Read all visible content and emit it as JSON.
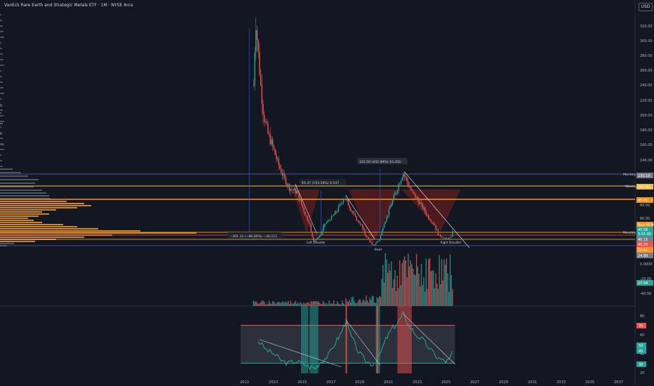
{
  "header": {
    "title": "VanEck Rare Earth and Strategic Metals ETF · 1M · NYSE Arca",
    "currency_button": "USD"
  },
  "chart_data": [
    {
      "type": "candlestick",
      "panel": "price",
      "x_ticks": [
        "2011",
        "2013",
        "2015",
        "2017",
        "2019",
        "2021",
        "2023",
        "2025",
        "2027",
        "2029",
        "2031",
        "2033",
        "2035",
        "2037"
      ],
      "y_ticks": [
        320,
        300,
        280,
        260,
        240,
        220,
        200,
        180,
        160,
        140,
        80,
        60,
        "0.0000",
        "-20.00",
        "-40.00"
      ],
      "price_series": [
        [
          "2011.6",
          240
        ],
        [
          "2011.75",
          330
        ],
        [
          "2011.9",
          290
        ],
        [
          "2012.1",
          240
        ],
        [
          "2012.3",
          200
        ],
        [
          "2012.6",
          175
        ],
        [
          "2012.9",
          160
        ],
        [
          "2013.3",
          135
        ],
        [
          "2013.7",
          115
        ],
        [
          "2014.1",
          100
        ],
        [
          "2014.6",
          95
        ],
        [
          "2015.0",
          75
        ],
        [
          "2015.4",
          55
        ],
        [
          "2015.8",
          28
        ],
        [
          "2016.3",
          40
        ],
        [
          "2016.8",
          55
        ],
        [
          "2017.4",
          70
        ],
        [
          "2017.9",
          88
        ],
        [
          "2018.3",
          75
        ],
        [
          "2018.9",
          52
        ],
        [
          "2019.5",
          35
        ],
        [
          "2019.9",
          21
        ],
        [
          "2020.3",
          30
        ],
        [
          "2020.7",
          52
        ],
        [
          "2021.1",
          75
        ],
        [
          "2021.6",
          100
        ],
        [
          "2022.0",
          122
        ],
        [
          "2022.5",
          98
        ],
        [
          "2023.0",
          85
        ],
        [
          "2023.5",
          70
        ],
        [
          "2024.0",
          52
        ],
        [
          "2024.5",
          38
        ],
        [
          "2025.0",
          32
        ],
        [
          "2025.3",
          34
        ],
        [
          "2025.5",
          45
        ]
      ],
      "annotations": {
        "rise_measure": "65.47 (193.58%) 6,547",
        "big_rise_measure": "103.50 (432.89%) 10,350",
        "drop_measure": "−301.12 (−86.80%) −30,112",
        "left_shoulder": "Left Shoulder",
        "head": "Head",
        "right_shoulder": "Right Shoulder",
        "monthly_upper": "Monthly",
        "weekly": "Weekly",
        "monthly_lower": "Monthly"
      },
      "price_labels": [
        {
          "text": "130.18",
          "color": "#787b86"
        },
        {
          "text": "102.52",
          "color": "#f0c24c"
        },
        {
          "text": "85.41",
          "color": "#f7931a"
        },
        {
          "text": "Buy 46.90",
          "color": "#f7931a"
        },
        {
          "text": "45.56",
          "color": "#26a69a"
        },
        {
          "text": "3:01:00",
          "color": "#26a69a"
        },
        {
          "text": "40.15",
          "color": "#787b86"
        },
        {
          "text": "40.25",
          "color": "#ef5350"
        },
        {
          "text": "32.51",
          "color": "#f7931a"
        },
        {
          "text": "24.89",
          "color": "#787b86"
        },
        {
          "text": "27.58",
          "color": "#26a69a"
        }
      ]
    },
    {
      "type": "line",
      "panel": "rsi",
      "y_ticks": [
        80,
        60,
        40,
        20
      ],
      "values": [
        [
          "2011.9",
          54
        ],
        [
          "2012.5",
          44
        ],
        [
          "2013.0",
          40
        ],
        [
          "2013.5",
          33
        ],
        [
          "2014.0",
          30
        ],
        [
          "2014.5",
          32
        ],
        [
          "2015.0",
          30
        ],
        [
          "2015.5",
          26
        ],
        [
          "2015.9",
          25
        ],
        [
          "2016.3",
          32
        ],
        [
          "2016.8",
          38
        ],
        [
          "2017.3",
          52
        ],
        [
          "2017.7",
          62
        ],
        [
          "2018.0",
          75
        ],
        [
          "2018.4",
          58
        ],
        [
          "2018.9",
          42
        ],
        [
          "2019.4",
          32
        ],
        [
          "2019.9",
          29
        ],
        [
          "2020.3",
          36
        ],
        [
          "2020.8",
          55
        ],
        [
          "2021.2",
          66
        ],
        [
          "2021.6",
          72
        ],
        [
          "2022.0",
          82
        ],
        [
          "2022.4",
          70
        ],
        [
          "2022.9",
          60
        ],
        [
          "2023.4",
          54
        ],
        [
          "2023.9",
          44
        ],
        [
          "2024.4",
          36
        ],
        [
          "2024.9",
          32
        ],
        [
          "2025.2",
          33
        ],
        [
          "2025.5",
          46
        ]
      ],
      "band_labels": [
        {
          "text": "70",
          "color": "#ef5350"
        },
        {
          "text": "50",
          "color": "#26a69a"
        },
        {
          "text": "45",
          "color": "#26a69a"
        },
        {
          "text": "30",
          "color": "#26a69a"
        }
      ]
    }
  ]
}
